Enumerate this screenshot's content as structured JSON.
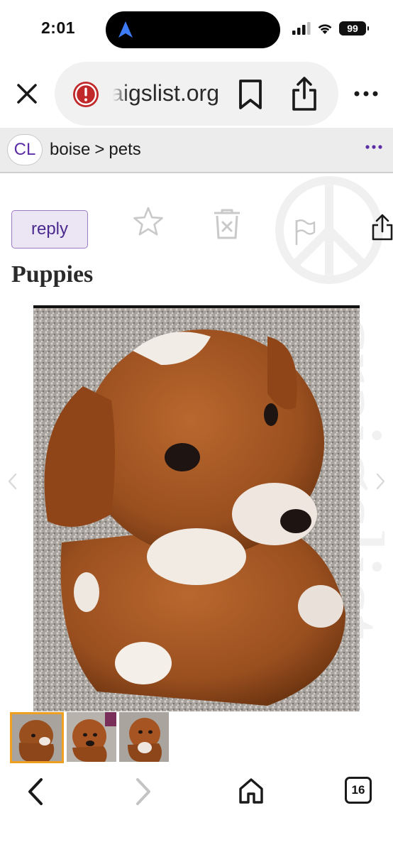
{
  "status_bar": {
    "time": "2:01",
    "battery": "99"
  },
  "browser": {
    "url": "craigslist.org",
    "tab_count": "16"
  },
  "site_header": {
    "logo": "CL",
    "breadcrumb": {
      "city": "boise",
      "separator": ">",
      "category": "pets"
    }
  },
  "post": {
    "reply_label": "reply",
    "title": "Puppies"
  },
  "gallery": {
    "image_count": 3,
    "active_index": 0
  },
  "watermark_text": "craigslist",
  "colors": {
    "accent_purple": "#5b2ea6",
    "reply_bg": "#ece5f3",
    "active_thumb_border": "#f0a020",
    "warning_red": "#c0282a"
  }
}
